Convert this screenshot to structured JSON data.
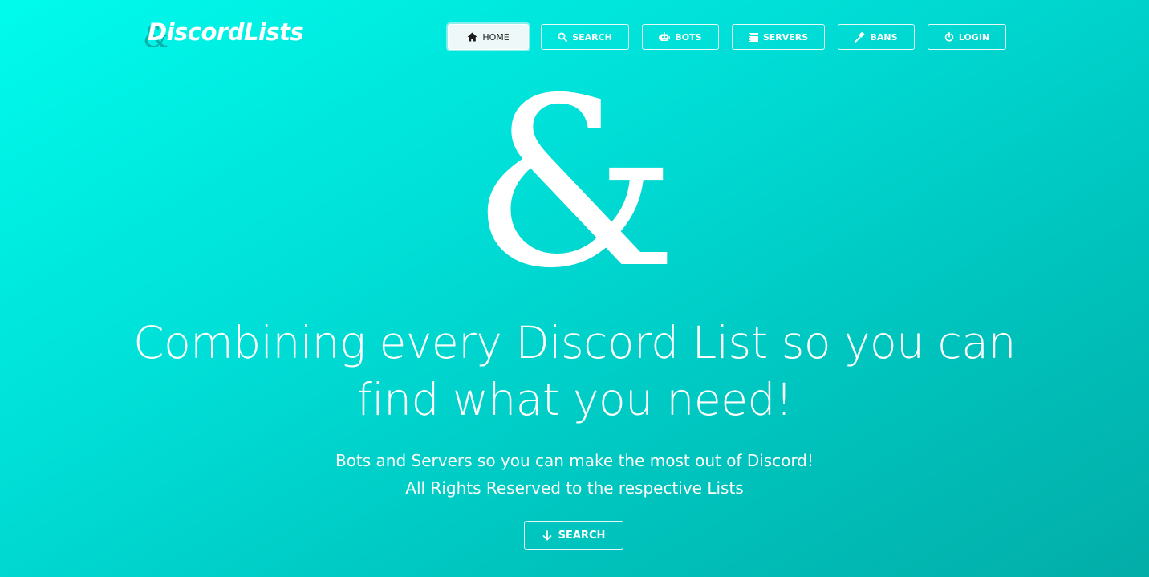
{
  "brand": {
    "logo_mark": "&",
    "name": "DiscordLists"
  },
  "nav": {
    "items": [
      {
        "label": "HOME",
        "icon": "home-icon",
        "active": true
      },
      {
        "label": "SEARCH",
        "icon": "search-icon",
        "active": false
      },
      {
        "label": "BOTS",
        "icon": "robot-icon",
        "active": false
      },
      {
        "label": "SERVERS",
        "icon": "server-list-icon",
        "active": false
      },
      {
        "label": "BANS",
        "icon": "gavel-icon",
        "active": false
      },
      {
        "label": "LOGIN",
        "icon": "power-icon",
        "active": false
      }
    ]
  },
  "hero": {
    "symbol": "&",
    "headline_line1": "Combining every Discord List so you can",
    "headline_line2": "find what you need!",
    "subtitle_line1": "Bots and Servers so you can make the most out of Discord!",
    "subtitle_line2": "All Rights Reserved to the respective Lists",
    "cta_label": "SEARCH",
    "cta_icon": "arrow-down-icon"
  },
  "colors": {
    "gradient_start": "#00fbec",
    "gradient_end": "#03ada8",
    "text": "#ffffff",
    "active_button_bg": "#eef8f8"
  }
}
